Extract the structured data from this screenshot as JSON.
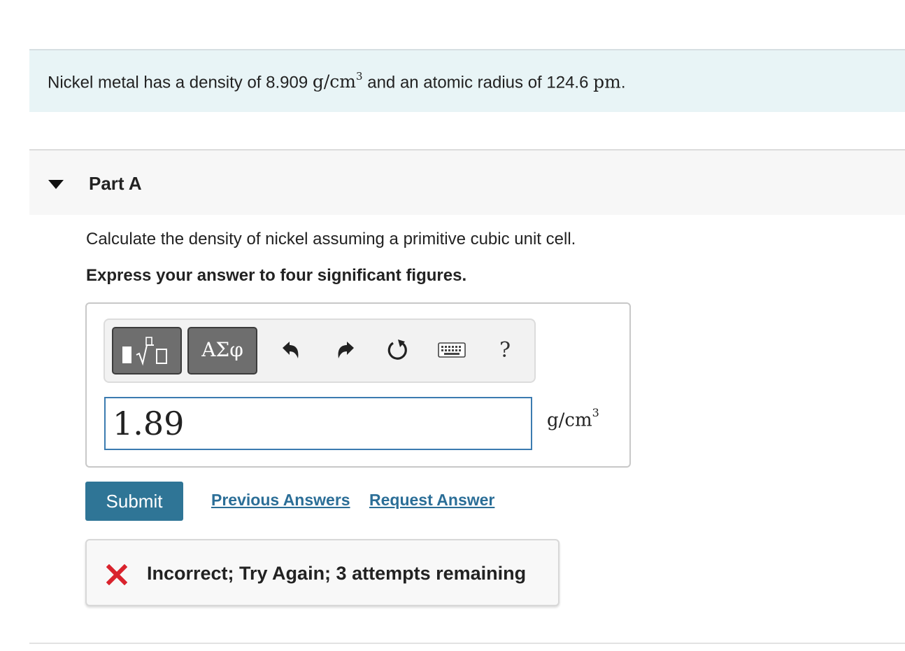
{
  "intro": {
    "text_before": "Nickel metal has a density of ",
    "density_value": "8.909",
    "density_unit": "g/cm",
    "density_unit_exp": "3",
    "text_middle": " and an atomic radius of ",
    "radius_value": "124.6",
    "radius_unit": "pm",
    "text_end": "."
  },
  "part": {
    "title": "Part A",
    "question": "Calculate the density of nickel assuming a primitive cubic unit cell.",
    "instruction": "Express your answer to four significant figures."
  },
  "toolbar": {
    "greek_label": "ΑΣφ",
    "help_label": "?",
    "icons": [
      "templates-icon",
      "greek-letters-icon",
      "undo-icon",
      "redo-icon",
      "reset-icon",
      "keyboard-icon",
      "help-icon"
    ]
  },
  "answer": {
    "value": "1.89",
    "unit": "g/cm",
    "unit_exp": "3"
  },
  "actions": {
    "submit_label": "Submit",
    "previous_answers_label": "Previous Answers",
    "request_answer_label": "Request Answer"
  },
  "feedback": {
    "message": "Incorrect; Try Again; 3 attempts remaining"
  },
  "colors": {
    "intro_bg": "#e8f4f6",
    "submit_bg": "#2f7596",
    "link": "#2b6e97",
    "error_x": "#d9232d",
    "input_border": "#3b7bb0"
  }
}
